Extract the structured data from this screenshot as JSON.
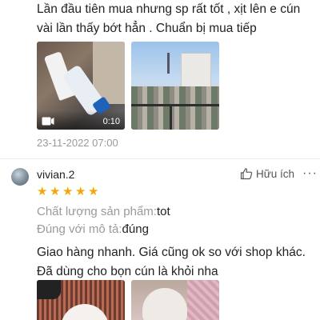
{
  "review1": {
    "text": "Lần đầu tiên mua nhưng sp rất tốt , xịt lên e cún vài lần thấy bớt hẳn . Chuẩn bị mua tiếp",
    "video_duration": "0:10",
    "timestamp": "23-11-2022 07:00"
  },
  "review2": {
    "reviewer_name": "vivian.2",
    "like_label": "Hữu ích",
    "more_label": "···",
    "rating": 5,
    "stars": [
      "★",
      "★",
      "★",
      "★",
      "★"
    ],
    "attributes": [
      {
        "label": "Chất lượng sản phẩm:",
        "value": "tot"
      },
      {
        "label": "Đúng với mô tả:",
        "value": "đúng"
      }
    ],
    "text": "Giao hàng nhanh. Giá cũng ok so với shop khác. Đã dùng cho bọn cún là khỏi nha"
  },
  "colors": {
    "star": "#f6a609",
    "muted": "#9a9a9a",
    "text": "#222222"
  }
}
